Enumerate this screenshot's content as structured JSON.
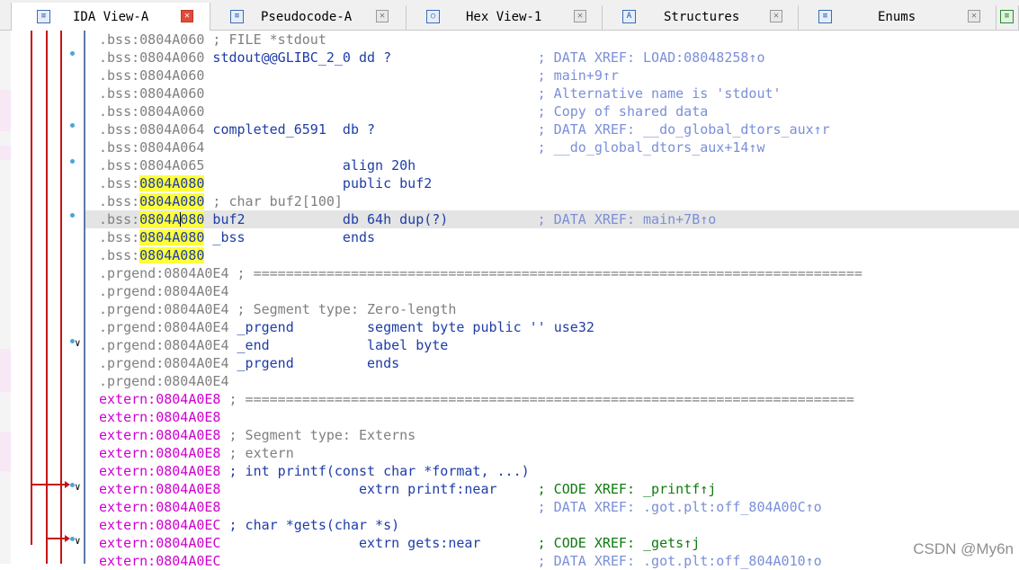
{
  "tabs": [
    {
      "label": "IDA View-A",
      "icon": "listing-icon"
    },
    {
      "label": "Pseudocode-A",
      "icon": "pseudocode-icon"
    },
    {
      "label": "Hex View-1",
      "icon": "hex-icon"
    },
    {
      "label": "Structures",
      "icon": "structures-icon"
    },
    {
      "label": "Enums",
      "icon": "enums-icon"
    }
  ],
  "lines": [
    {
      "seg": ".bss:",
      "addr": "0804A060",
      "text": " ; FILE *stdout",
      "kind": "bss"
    },
    {
      "seg": ".bss:",
      "addr": "0804A060",
      "text": " stdout@@GLIBC_2_0 dd ?",
      "cmt": "; DATA XREF: LOAD:08048258↑o",
      "kind": "bss"
    },
    {
      "seg": ".bss:",
      "addr": "0804A060",
      "text": "",
      "cmt": "; main+9↑r",
      "kind": "bss"
    },
    {
      "seg": ".bss:",
      "addr": "0804A060",
      "text": "",
      "cmt": "; Alternative name is 'stdout'",
      "kind": "bss"
    },
    {
      "seg": ".bss:",
      "addr": "0804A060",
      "text": "",
      "cmt": "; Copy of shared data",
      "kind": "bss"
    },
    {
      "seg": ".bss:",
      "addr": "0804A064",
      "text": " completed_6591  db ?",
      "cmt": "; DATA XREF: __do_global_dtors_aux↑r",
      "kind": "bss"
    },
    {
      "seg": ".bss:",
      "addr": "0804A064",
      "text": "",
      "cmt": "; __do_global_dtors_aux+14↑w",
      "kind": "bss"
    },
    {
      "seg": ".bss:",
      "addr": "0804A065",
      "text": "                 align 20h",
      "kind": "bss"
    },
    {
      "seg": ".bss:",
      "addr": "0804A080",
      "text": "                 public buf2",
      "kind": "bsshi"
    },
    {
      "seg": ".bss:",
      "addr": "0804A080",
      "text": " ; char buf2[100]",
      "kind": "bsshi"
    },
    {
      "seg": ".bss:",
      "addr": "0804A080",
      "text": " buf2            db 64h dup(?)",
      "cmt": "; DATA XREF: main+7B↑o",
      "kind": "bsshi"
    },
    {
      "seg": ".bss:",
      "addr": "0804A080",
      "text": " _bss            ends",
      "kind": "bsshi"
    },
    {
      "seg": ".bss:",
      "addr": "0804A080",
      "text": "",
      "kind": "bsshi"
    },
    {
      "seg": ".prgend:",
      "addr": "0804A0E4",
      "text": " ; ===========================================================================",
      "kind": "prg"
    },
    {
      "seg": ".prgend:",
      "addr": "0804A0E4",
      "text": "",
      "kind": "prg"
    },
    {
      "seg": ".prgend:",
      "addr": "0804A0E4",
      "text": " ; Segment type: Zero-length",
      "kind": "prg"
    },
    {
      "seg": ".prgend:",
      "addr": "0804A0E4",
      "text": " _prgend         segment byte public '' use32",
      "kind": "prg"
    },
    {
      "seg": ".prgend:",
      "addr": "0804A0E4",
      "text": " _end            label byte",
      "kind": "prg"
    },
    {
      "seg": ".prgend:",
      "addr": "0804A0E4",
      "text": " _prgend         ends",
      "kind": "prg"
    },
    {
      "seg": ".prgend:",
      "addr": "0804A0E4",
      "text": "",
      "kind": "prg"
    },
    {
      "seg": "extern:",
      "addr": "0804A0E8",
      "text": " ; ===========================================================================",
      "kind": "ext"
    },
    {
      "seg": "extern:",
      "addr": "0804A0E8",
      "text": "",
      "kind": "ext"
    },
    {
      "seg": "extern:",
      "addr": "0804A0E8",
      "text": " ; Segment type: Externs",
      "kind": "ext"
    },
    {
      "seg": "extern:",
      "addr": "0804A0E8",
      "text": " ; extern",
      "kind": "ext"
    },
    {
      "seg": "extern:",
      "addr": "0804A0E8",
      "text": " ; int printf(const char *format, ...)",
      "kind": "ext"
    },
    {
      "seg": "extern:",
      "addr": "0804A0E8",
      "text": "                 extrn printf:near",
      "cmt": "; CODE XREF: _printf↑j",
      "kind": "ext"
    },
    {
      "seg": "extern:",
      "addr": "0804A0E8",
      "text": "",
      "cmt": "; DATA XREF: .got.plt:off_804A00C↑o",
      "kind": "ext"
    },
    {
      "seg": "extern:",
      "addr": "0804A0EC",
      "text": " ; char *gets(char *s)",
      "kind": "ext"
    },
    {
      "seg": "extern:",
      "addr": "0804A0EC",
      "text": "                 extrn gets:near",
      "cmt": "; CODE XREF: _gets↑j",
      "kind": "ext"
    },
    {
      "seg": "extern:",
      "addr": "0804A0EC",
      "text": "",
      "cmt": "; DATA XREF: .got.plt:off_804A010↑o",
      "kind": "ext"
    }
  ],
  "watermark": "CSDN @My6n",
  "colors": {
    "highlight": "#ffff3a",
    "extern": "#d000d0",
    "arrow": "#c61414",
    "name": "#1e3da8"
  }
}
